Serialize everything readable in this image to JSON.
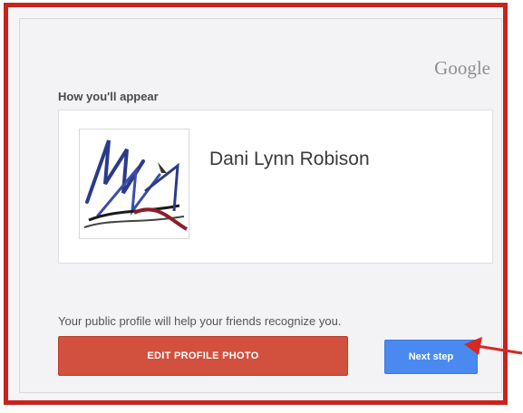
{
  "brand": {
    "logo_text": "Google"
  },
  "card": {
    "heading": "How you'll appear",
    "profile": {
      "name": "Dani Lynn Robison",
      "avatar": {
        "description_icon": "signature-photo",
        "colors": [
          "#2b3b8a",
          "#8c1f2a",
          "#1a1a1a"
        ]
      }
    },
    "helper_text": "Your public profile will help your friends recognize you.",
    "buttons": {
      "edit_label": "EDIT PROFILE PHOTO",
      "next_label": "Next step"
    }
  },
  "annotation": {
    "frame_color": "#c8231d",
    "arrow_color": "#d42a22"
  },
  "colors": {
    "edit_button": "#d2503e",
    "next_button": "#4a8af0"
  }
}
